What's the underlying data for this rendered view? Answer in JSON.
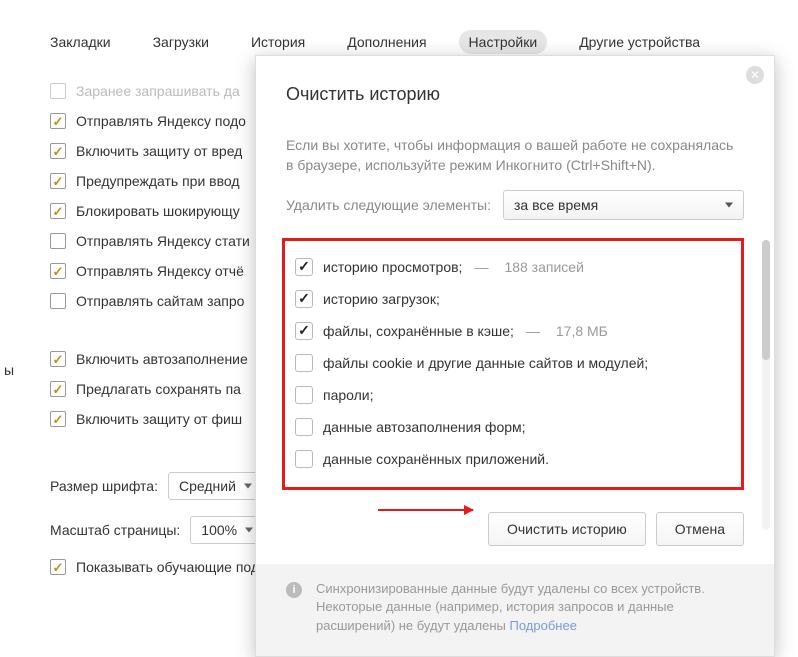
{
  "tabs": {
    "bookmarks": "Закладки",
    "downloads": "Загрузки",
    "history": "История",
    "addons": "Дополнения",
    "settings": "Настройки",
    "other_devices": "Другие устройства"
  },
  "settings": {
    "s0": "Заранее запрашивать да",
    "s1": "Отправлять Яндексу подо",
    "s2": "Включить защиту от вред",
    "s3": "Предупреждать при ввод",
    "s4": "Блокировать шокирующу",
    "s5": "Отправлять Яндексу стати",
    "s6": "Отправлять Яндексу отчё",
    "s7": "Отправлять сайтам запро",
    "s8": "Включить автозаполнение",
    "s9": "Предлагать сохранять па",
    "s10": "Включить защиту от фиш",
    "font_label": "Размер шрифта:",
    "font_value": "Средний",
    "zoom_label": "Масштаб страницы:",
    "zoom_value": "100%",
    "s11": "Показывать обучающие подсказки"
  },
  "gutter": "ы",
  "modal": {
    "title": "Очистить историю",
    "subtitle": "Если вы хотите, чтобы информация о вашей работе не сохранялась в браузере, используйте режим Инкогнито (Ctrl+Shift+N).",
    "delete_label": "Удалить следующие элементы:",
    "time_value": "за все время",
    "items": {
      "i1_label": "историю просмотров;",
      "i1_meta": "188 записей",
      "i2_label": "историю загрузок;",
      "i3_label": "файлы, сохранённые в кэше;",
      "i3_meta": "17,8 МБ",
      "i4_label": "файлы cookie и другие данные сайтов и модулей;",
      "i5_label": "пароли;",
      "i6_label": "данные автозаполнения форм;",
      "i7_label": "данные сохранённых приложений."
    },
    "btn_clear": "Очистить историю",
    "btn_cancel": "Отмена",
    "footer_text": "Синхронизированные данные будут удалены со всех устройств. Некоторые данные (например, история запросов и данные расширений) не будут удалены ",
    "footer_link": "Подробнее"
  }
}
